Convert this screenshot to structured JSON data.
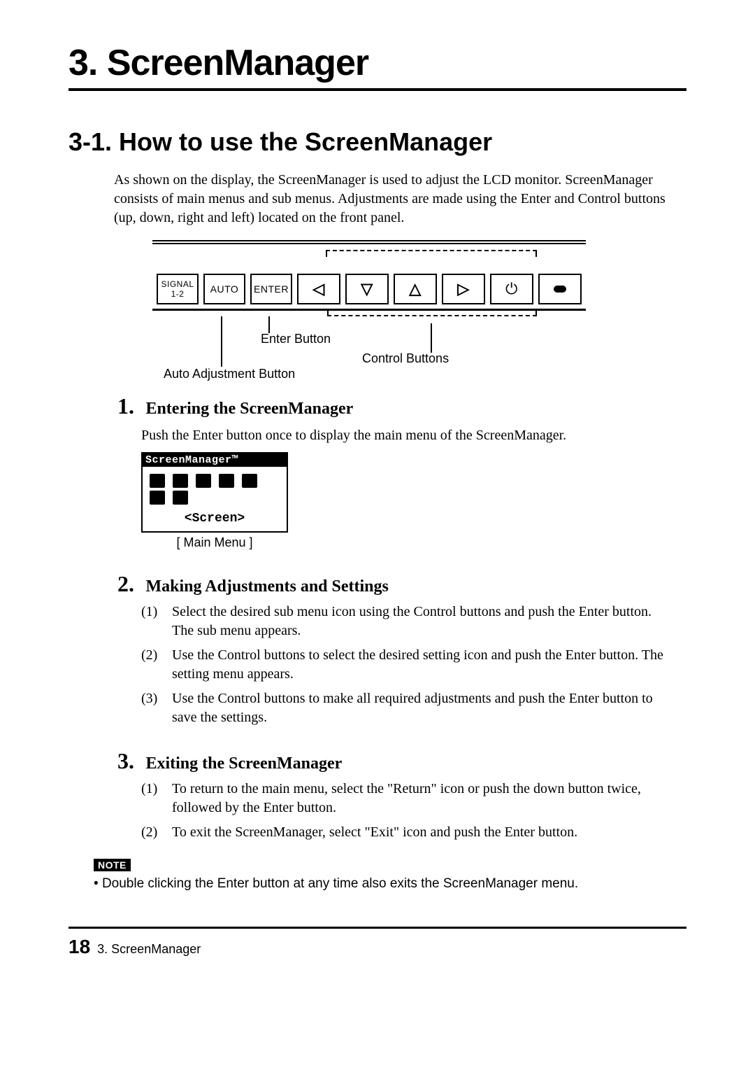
{
  "chapter_title": "3. ScreenManager",
  "section_title": "3-1.  How to use the ScreenManager",
  "intro_text": "As shown on the display, the ScreenManager is used to adjust the LCD monitor. ScreenManager consists of main menus and sub menus.  Adjustments are made using the Enter and Control buttons (up, down, right and left) located on the front panel.",
  "panel": {
    "signal_label_top": "SIGNAL",
    "signal_label_bottom": "1-2",
    "auto_label": "AUTO",
    "enter_label": "ENTER",
    "arrow_left": "◁",
    "arrow_down": "▽",
    "arrow_up": "△",
    "arrow_right": "▷",
    "power_glyph": "⏻",
    "enter_caption": "Enter Button",
    "control_caption": "Control Buttons",
    "auto_caption": "Auto Adjustment Button"
  },
  "steps": {
    "s1": {
      "num": "1.",
      "title": "Entering the ScreenManager",
      "body": "Push the Enter button once to display the main menu of the ScreenManager.",
      "osd_title": "ScreenManager™",
      "osd_selection": "<Screen>",
      "osd_caption": "[ Main Menu ]"
    },
    "s2": {
      "num": "2.",
      "title": "Making Adjustments and Settings",
      "items": [
        {
          "n": "(1)",
          "t": "Select the desired sub menu icon using the Control buttons and push the Enter button.  The sub menu appears."
        },
        {
          "n": "(2)",
          "t": "Use the Control buttons to select the desired setting icon and push the Enter button.  The setting menu appears."
        },
        {
          "n": "(3)",
          "t": "Use the Control buttons to make all required adjustments and push the Enter button to save the settings."
        }
      ]
    },
    "s3": {
      "num": "3.",
      "title": "Exiting the ScreenManager",
      "items": [
        {
          "n": "(1)",
          "t": "To return to the main menu, select the \"Return\" icon or push the down button twice, followed by the Enter button."
        },
        {
          "n": "(2)",
          "t": "To exit the ScreenManager, select \"Exit\" icon and push the Enter button."
        }
      ]
    }
  },
  "note_label": "NOTE",
  "note_text": "Double clicking the Enter button at any time also exits the ScreenManager menu.",
  "footer": {
    "page": "18",
    "title": "3. ScreenManager"
  }
}
